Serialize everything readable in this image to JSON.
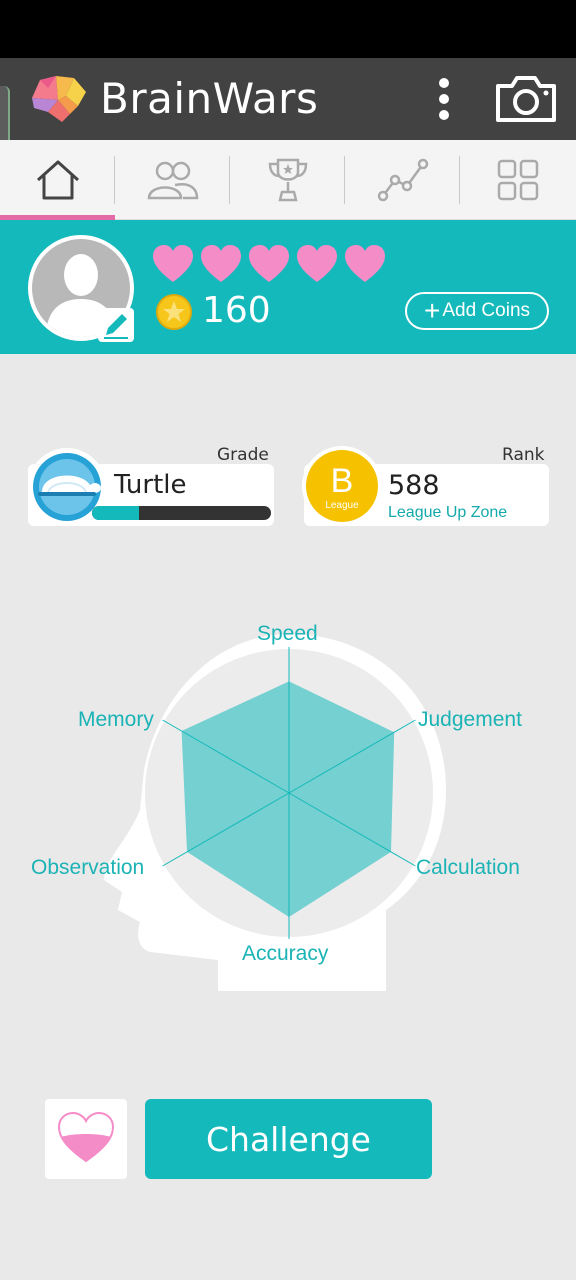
{
  "app": {
    "title": "BrainWars",
    "logo_icon": "brain-logo-icon",
    "more_icon": "more-vertical-icon",
    "camera_icon": "camera-icon"
  },
  "tabs": [
    {
      "name": "home",
      "icon": "home-icon",
      "active": true
    },
    {
      "name": "friends",
      "icon": "friends-icon",
      "active": false
    },
    {
      "name": "trophy",
      "icon": "trophy-icon",
      "active": false
    },
    {
      "name": "stats",
      "icon": "line-chart-icon",
      "active": false
    },
    {
      "name": "menu",
      "icon": "grid-icon",
      "active": false
    }
  ],
  "profile": {
    "hearts": 5,
    "coins": "160",
    "add_coins_plus": "+",
    "add_coins_label": "Add Coins"
  },
  "grade": {
    "heading": "Grade",
    "name": "Turtle",
    "progress": 0.26
  },
  "rank": {
    "heading": "Rank",
    "badge_letter": "B",
    "badge_caption": "League",
    "value": "588",
    "zone": "League Up Zone"
  },
  "radar": {
    "axes": [
      "Speed",
      "Judgement",
      "Calculation",
      "Accuracy",
      "Observation",
      "Memory"
    ],
    "values": [
      0.9,
      0.98,
      0.95,
      1.0,
      0.95,
      1.0
    ]
  },
  "actions": {
    "heart_icon": "heart-icon",
    "challenge_label": "Challenge"
  },
  "colors": {
    "accent": "#13b9bb",
    "active_tab": "#e36aa6",
    "heart": "#f48cc8",
    "coin": "#f6c61b"
  }
}
